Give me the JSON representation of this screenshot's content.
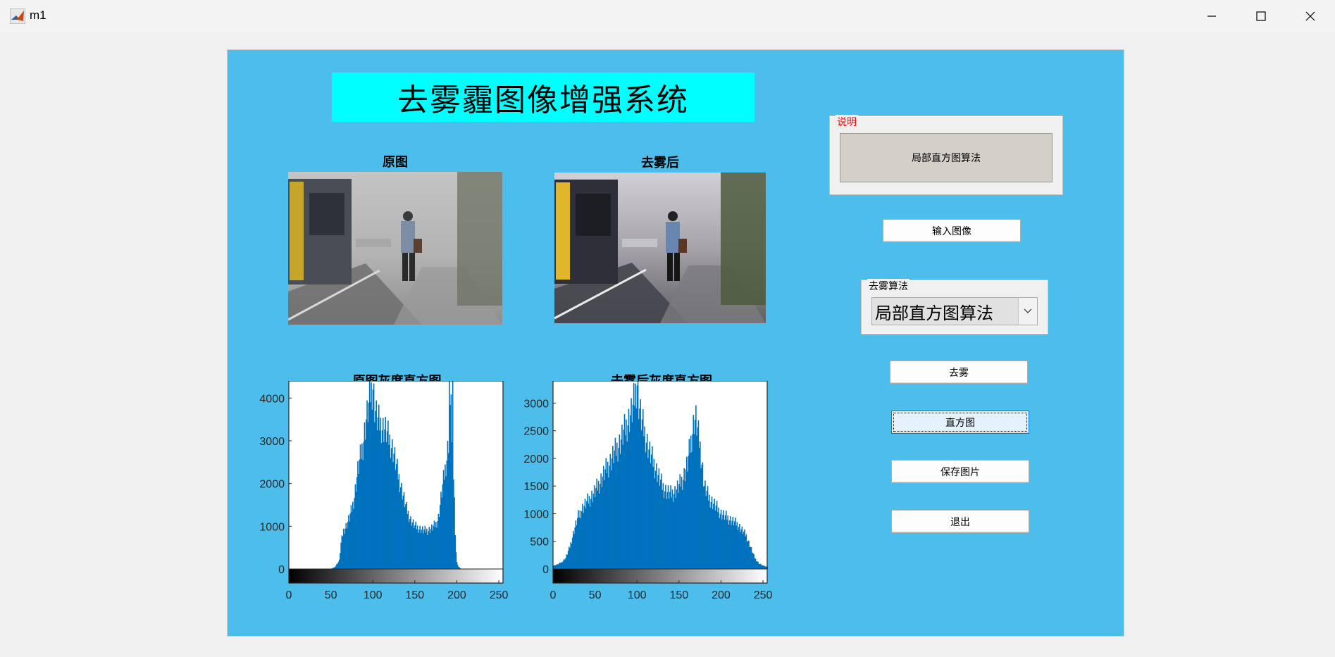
{
  "window": {
    "title": "m1"
  },
  "figure": {
    "main_title": "去雾霾图像增强系统",
    "original_image_title": "原图",
    "dehazed_image_title": "去雾后",
    "original_hist_title": "原图灰度直方图",
    "dehazed_hist_title": "去雾后灰度直方图"
  },
  "info_panel": {
    "legend": "说明",
    "text": "局部直方图算法",
    "legend_color": "#ff0000"
  },
  "controls": {
    "input_image_button": "输入图像",
    "algorithm_panel_legend": "去雾算法",
    "algorithm_selected": "局部直方图算法",
    "dehaze_button": "去雾",
    "histogram_button": "直方图",
    "save_button": "保存图片",
    "exit_button": "退出"
  },
  "colors": {
    "figure_background": "#4dbeec",
    "title_background": "#00ffff",
    "bar_color": "#0072bd"
  },
  "chart_data": [
    {
      "type": "bar",
      "title": "原图灰度直方图",
      "x_ticks": [
        0,
        50,
        100,
        150,
        200,
        250
      ],
      "y_ticks": [
        0,
        1000,
        2000,
        3000,
        4000
      ],
      "xlim": [
        0,
        255
      ],
      "ylim": [
        0,
        4400
      ],
      "x": [
        30,
        40,
        50,
        55,
        60,
        62,
        65,
        68,
        70,
        72,
        75,
        78,
        80,
        82,
        85,
        88,
        90,
        92,
        95,
        97,
        100,
        102,
        105,
        108,
        110,
        112,
        115,
        118,
        120,
        122,
        125,
        128,
        130,
        135,
        140,
        145,
        150,
        155,
        160,
        165,
        170,
        175,
        178,
        180,
        182,
        185,
        188,
        190,
        191,
        192,
        193,
        194,
        195,
        196,
        197,
        198,
        199,
        200,
        202,
        205,
        210
      ],
      "values": [
        0,
        0,
        0,
        50,
        200,
        600,
        900,
        1000,
        1100,
        1200,
        1400,
        1700,
        2000,
        2300,
        2600,
        2900,
        3200,
        3500,
        3800,
        4100,
        4300,
        3800,
        3500,
        3400,
        3350,
        3300,
        3250,
        3100,
        3000,
        2900,
        2700,
        2400,
        2200,
        1800,
        1400,
        1150,
        1000,
        950,
        900,
        900,
        950,
        1050,
        1200,
        1500,
        1800,
        2200,
        2600,
        3000,
        4400,
        3500,
        4400,
        2900,
        4400,
        2200,
        1600,
        900,
        400,
        150,
        50,
        0,
        0
      ]
    },
    {
      "type": "bar",
      "title": "去雾后灰度直方图",
      "x_ticks": [
        0,
        50,
        100,
        150,
        200,
        250
      ],
      "y_ticks": [
        0,
        500,
        1000,
        1500,
        2000,
        2500,
        3000
      ],
      "xlim": [
        0,
        255
      ],
      "ylim": [
        0,
        3400
      ],
      "x": [
        0,
        5,
        10,
        15,
        20,
        25,
        30,
        35,
        40,
        45,
        50,
        55,
        60,
        65,
        70,
        75,
        80,
        85,
        90,
        95,
        100,
        102,
        105,
        110,
        115,
        120,
        125,
        130,
        135,
        140,
        145,
        150,
        155,
        160,
        163,
        165,
        168,
        170,
        172,
        175,
        178,
        180,
        185,
        190,
        195,
        200,
        205,
        210,
        215,
        220,
        225,
        230,
        235,
        240,
        245,
        250,
        255
      ],
      "values": [
        60,
        80,
        120,
        200,
        400,
        700,
        950,
        1100,
        1200,
        1300,
        1400,
        1550,
        1700,
        1850,
        2000,
        2150,
        2300,
        2500,
        2700,
        2900,
        3400,
        3000,
        2700,
        2400,
        2100,
        1900,
        1700,
        1500,
        1400,
        1350,
        1400,
        1500,
        1650,
        1900,
        2200,
        2400,
        2700,
        2700,
        2500,
        2200,
        1800,
        1500,
        1300,
        1200,
        1100,
        1000,
        950,
        900,
        850,
        800,
        700,
        600,
        400,
        200,
        100,
        60,
        40
      ]
    }
  ]
}
